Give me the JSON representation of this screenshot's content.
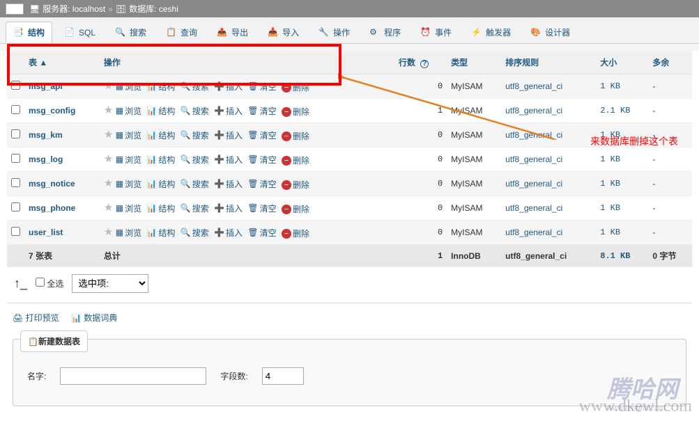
{
  "breadcrumb": {
    "back": "←",
    "server_label": "服务器: localhost",
    "db_label": "数据库: ceshi"
  },
  "tabs": [
    {
      "id": "structure",
      "label": "结构",
      "active": true
    },
    {
      "id": "sql",
      "label": "SQL"
    },
    {
      "id": "search",
      "label": "搜索"
    },
    {
      "id": "query",
      "label": "查询"
    },
    {
      "id": "export",
      "label": "导出"
    },
    {
      "id": "import",
      "label": "导入"
    },
    {
      "id": "operations",
      "label": "操作"
    },
    {
      "id": "procedures",
      "label": "程序"
    },
    {
      "id": "events",
      "label": "事件"
    },
    {
      "id": "triggers",
      "label": "触发器"
    },
    {
      "id": "designer",
      "label": "设计器"
    }
  ],
  "headers": {
    "table": "表",
    "actions": "操作",
    "rows": "行数",
    "type": "类型",
    "collation": "排序规则",
    "size": "大小",
    "overhead": "多余"
  },
  "actions": {
    "browse": "浏览",
    "structure": "结构",
    "search": "搜索",
    "insert": "插入",
    "empty": "清空",
    "drop": "删除"
  },
  "tables": [
    {
      "name": "msg_api",
      "rows": 0,
      "engine": "MyISAM",
      "collation": "utf8_general_ci",
      "size": "1 KB",
      "overhead": "-"
    },
    {
      "name": "msg_config",
      "rows": 1,
      "engine": "MyISAM",
      "collation": "utf8_general_ci",
      "size": "2.1 KB",
      "overhead": "-"
    },
    {
      "name": "msg_km",
      "rows": 0,
      "engine": "MyISAM",
      "collation": "utf8_general_ci",
      "size": "1 KB",
      "overhead": "-"
    },
    {
      "name": "msg_log",
      "rows": 0,
      "engine": "MyISAM",
      "collation": "utf8_general_ci",
      "size": "1 KB",
      "overhead": "-"
    },
    {
      "name": "msg_notice",
      "rows": 0,
      "engine": "MyISAM",
      "collation": "utf8_general_ci",
      "size": "1 KB",
      "overhead": "-"
    },
    {
      "name": "msg_phone",
      "rows": 0,
      "engine": "MyISAM",
      "collation": "utf8_general_ci",
      "size": "1 KB",
      "overhead": "-"
    },
    {
      "name": "user_list",
      "rows": 0,
      "engine": "MyISAM",
      "collation": "utf8_general_ci",
      "size": "1 KB",
      "overhead": "-"
    }
  ],
  "summary": {
    "count": "7 张表",
    "total": "总计",
    "rows": 1,
    "engine": "InnoDB",
    "collation": "utf8_general_ci",
    "size": "8.1 KB",
    "overhead": "0 字节"
  },
  "footer": {
    "check_all": "全选",
    "with_selected": "选中项:"
  },
  "links": {
    "print": "打印预览",
    "dict": "数据词典"
  },
  "new_table": {
    "button": "新建数据表",
    "name_label": "名字:",
    "cols_label": "字段数:",
    "cols_value": "4"
  },
  "annotation": {
    "text": "来数据库删掉这个表"
  }
}
